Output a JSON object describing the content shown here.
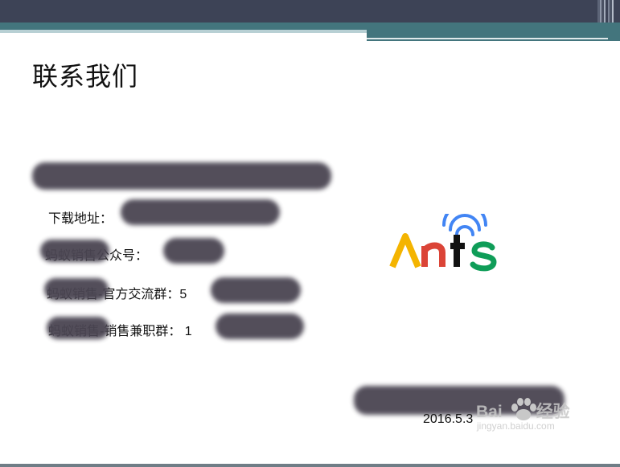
{
  "slide": {
    "title": "联系我们",
    "lines": [
      "下载地址：",
      "蚂蚁销售公众号：",
      "蚂蚁销售-官方交流群：5",
      "蚂蚁销售-销售兼职群： 1"
    ],
    "logo_text": "Ants",
    "date": "2016.5.3",
    "watermark": "Bai",
    "watermark_suffix": "经验",
    "watermark_url": "jingyan.baidu.com"
  },
  "colors": {
    "top_bar": "#3d4356",
    "teal_band": "#43757d",
    "logo_A": "#f4b400",
    "logo_n": "#db4437",
    "logo_t": "#111111",
    "logo_s": "#0f9d58",
    "wifi": "#4285f4"
  }
}
